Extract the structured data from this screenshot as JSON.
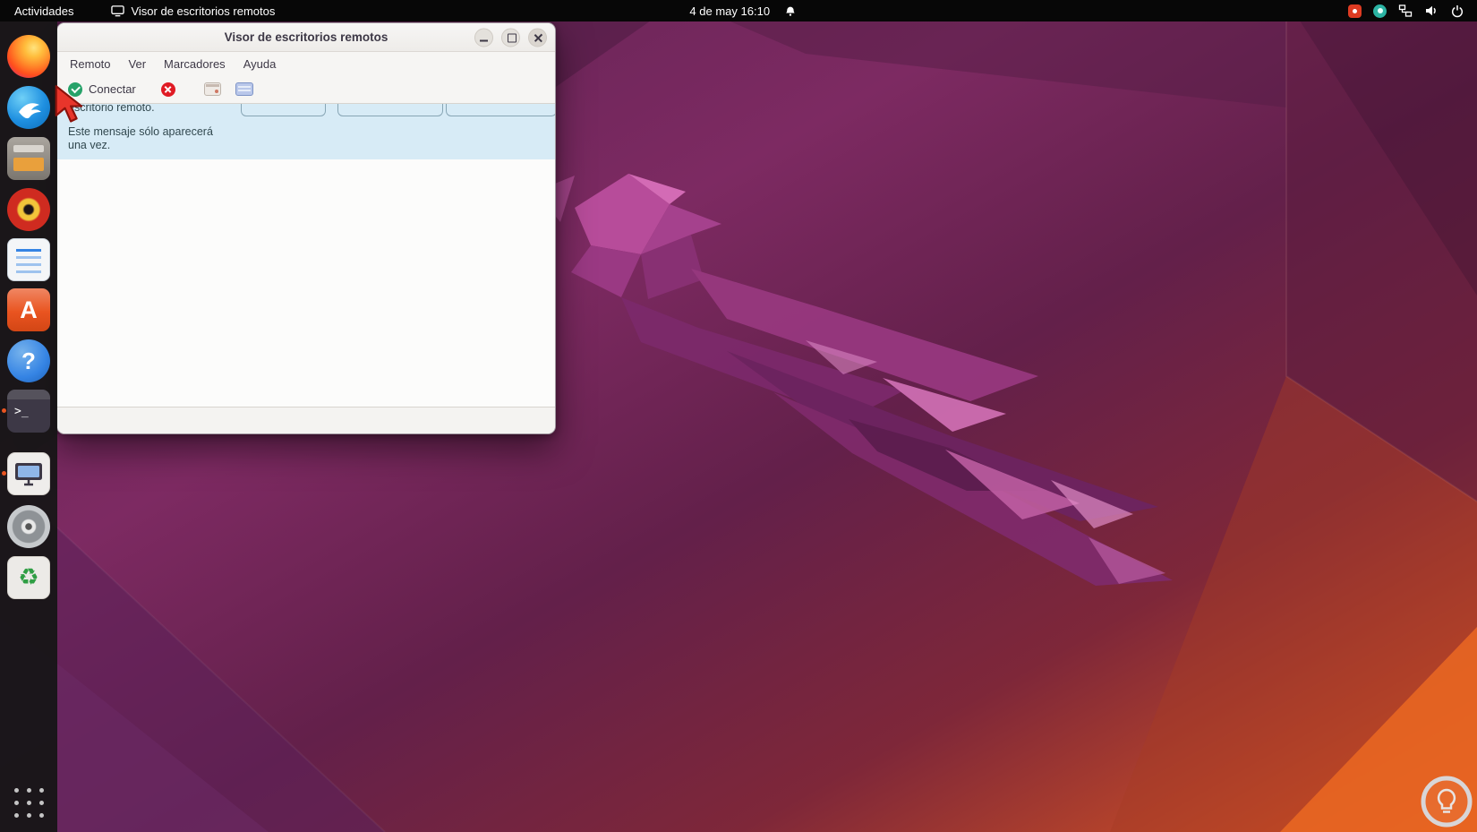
{
  "topbar": {
    "activities": "Actividades",
    "focused_app": "Visor de escritorios remotos",
    "clock": "4 de may 16:10"
  },
  "window": {
    "title": "Visor de escritorios remotos",
    "menu": {
      "remoto": "Remoto",
      "ver": "Ver",
      "marcadores": "Marcadores",
      "ayuda": "Ayuda"
    },
    "toolbar": {
      "connect": "Conectar"
    },
    "infobar": {
      "clipped_line": "escritorio remoto.",
      "message_line1": "Este mensaje sólo aparecerá",
      "message_line2": "una vez."
    }
  },
  "dock": {
    "items": [
      "firefox",
      "thunderbird",
      "files",
      "rhythmbox",
      "libreoffice-writer",
      "ubuntu-software",
      "help",
      "terminal",
      "remote-desktop-viewer",
      "disks",
      "recycler",
      "show-applications"
    ]
  },
  "colors": {
    "accent_orange": "#e95420",
    "connect_green": "#26a269",
    "disconnect_red": "#e01b24",
    "infobar_blue": "#d7ebf6",
    "annotation_red": "#e8352b"
  }
}
